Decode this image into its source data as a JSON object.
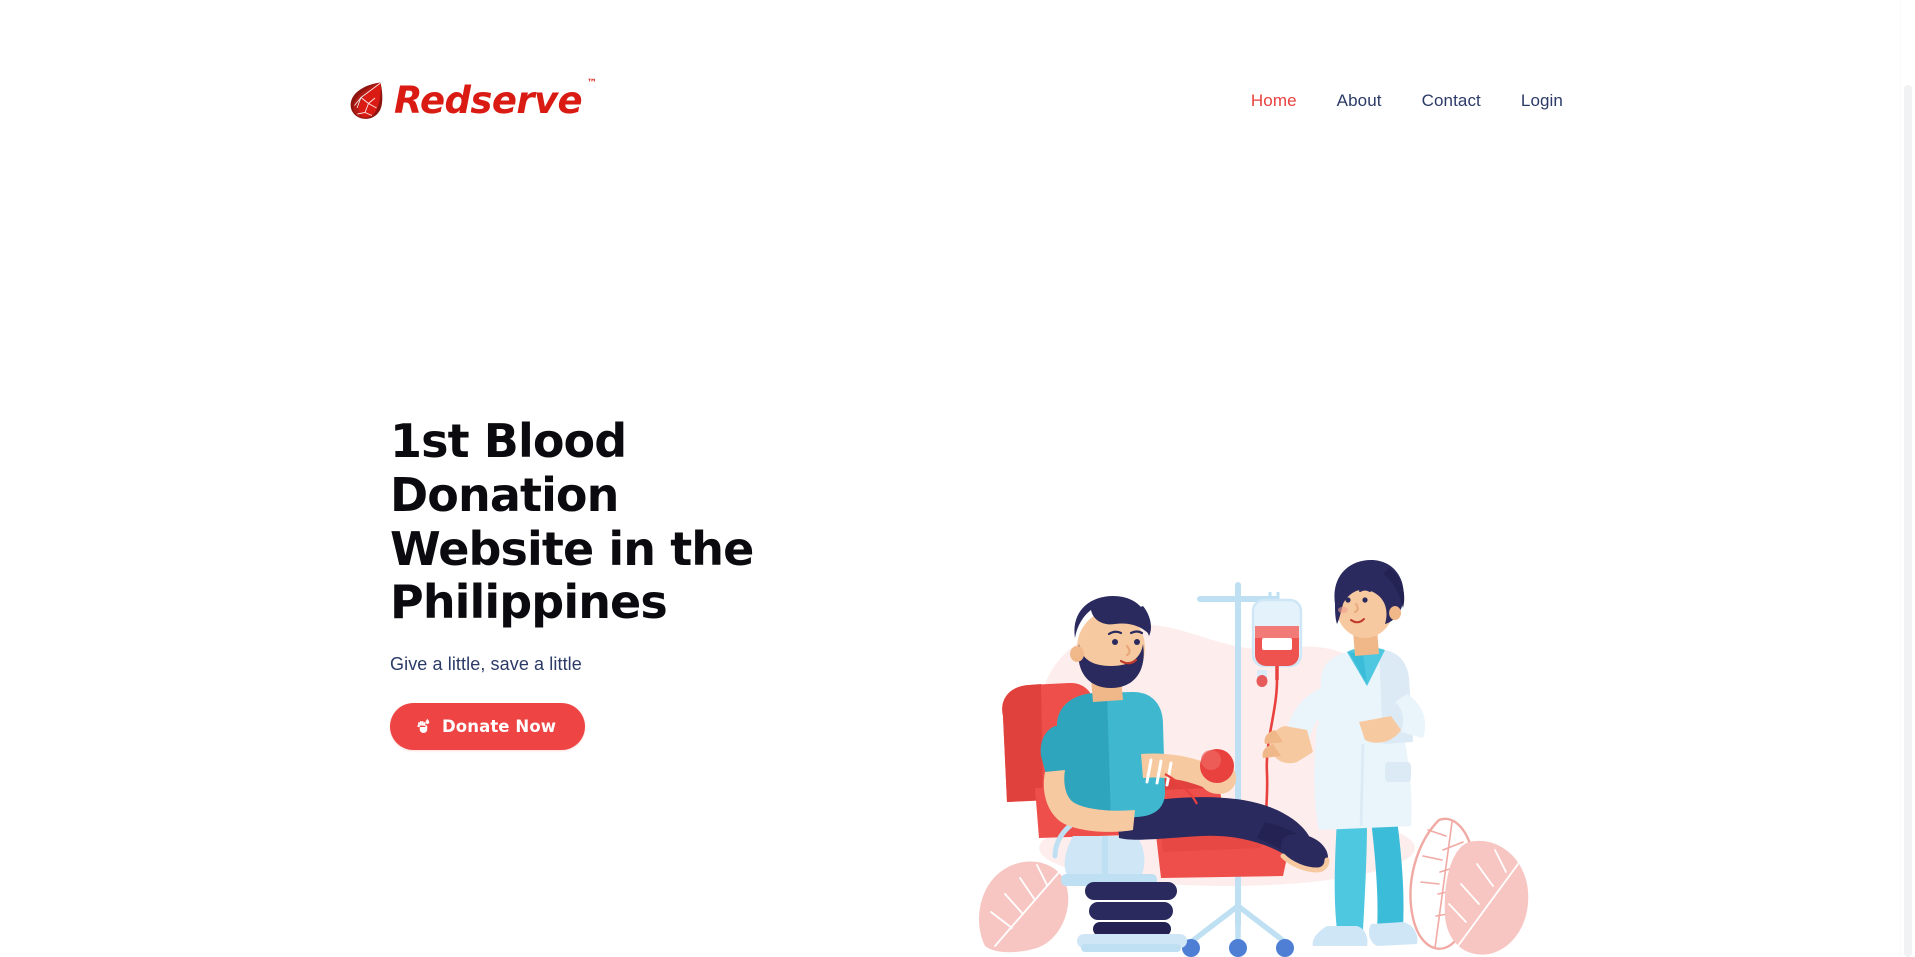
{
  "brand": {
    "name": "Redserve",
    "trademark": "™",
    "logo_icon": "blood-drop-leaf-icon",
    "color": "#d91b14"
  },
  "nav": {
    "items": [
      {
        "label": "Home",
        "active": true
      },
      {
        "label": "About",
        "active": false
      },
      {
        "label": "Contact",
        "active": false
      },
      {
        "label": "Login",
        "active": false
      }
    ],
    "active_color": "#e8413e",
    "inactive_color": "#2b3a67"
  },
  "hero": {
    "title": "1st Blood Donation Website in the Philippines",
    "subtitle": "Give a little, save a little",
    "cta": {
      "label": "Donate Now",
      "icon": "hand-blood-drop-icon",
      "background": "#ef4444",
      "text_color": "#ffffff"
    },
    "illustration": {
      "name": "blood-donation-illustration",
      "description": "Bearded man donating blood in a red reclining chair while a nurse holds a blood bag beside an IV stand, with pink leaves and a pale pink blob background",
      "palette": {
        "blob": "#fdeeed",
        "leaf": "#f8c6c2",
        "chair_red": "#ee4f4a",
        "chair_red_dark": "#e0413c",
        "shirt_teal": "#3fb8cf",
        "shirt_teal_dark": "#2ea5bd",
        "hair_navy": "#2b2a5e",
        "skin": "#f7c9a0",
        "coat_white": "#eaf4fb",
        "scrubs_blue": "#4ec7e0",
        "blood_red": "#e8413e",
        "stand_blue": "#bfe0f2",
        "caster_blue": "#4e7fd4"
      }
    }
  }
}
